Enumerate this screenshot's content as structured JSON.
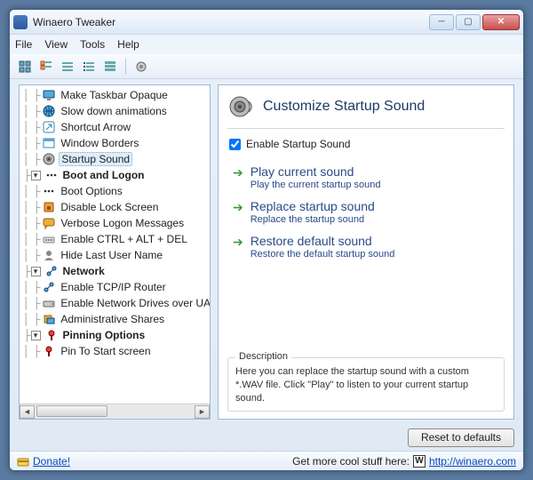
{
  "window": {
    "title": "Winaero Tweaker"
  },
  "menu": {
    "file": "File",
    "view": "View",
    "tools": "Tools",
    "help": "Help"
  },
  "tree": {
    "items": [
      {
        "indent": 2,
        "type": "leaf",
        "icon": "monitor",
        "label": "Make Taskbar Opaque"
      },
      {
        "indent": 2,
        "type": "leaf",
        "icon": "globe",
        "label": "Slow down animations"
      },
      {
        "indent": 2,
        "type": "leaf",
        "icon": "arrow",
        "label": "Shortcut Arrow"
      },
      {
        "indent": 2,
        "type": "leaf",
        "icon": "window",
        "label": "Window Borders"
      },
      {
        "indent": 2,
        "type": "leaf",
        "icon": "speaker",
        "label": "Startup Sound",
        "selected": true
      },
      {
        "indent": 1,
        "type": "group",
        "exp": "-",
        "icon": "dots",
        "label": "Boot and Logon"
      },
      {
        "indent": 2,
        "type": "leaf",
        "icon": "dots",
        "label": "Boot Options"
      },
      {
        "indent": 2,
        "type": "leaf",
        "icon": "lock",
        "label": "Disable Lock Screen"
      },
      {
        "indent": 2,
        "type": "leaf",
        "icon": "chat",
        "label": "Verbose Logon Messages"
      },
      {
        "indent": 2,
        "type": "leaf",
        "icon": "keys",
        "label": "Enable CTRL + ALT + DEL"
      },
      {
        "indent": 2,
        "type": "leaf",
        "icon": "user",
        "label": "Hide Last User Name"
      },
      {
        "indent": 1,
        "type": "group",
        "exp": "-",
        "icon": "net",
        "label": "Network"
      },
      {
        "indent": 2,
        "type": "leaf",
        "icon": "net",
        "label": "Enable TCP/IP Router"
      },
      {
        "indent": 2,
        "type": "leaf",
        "icon": "drive",
        "label": "Enable Network Drives over UAC"
      },
      {
        "indent": 2,
        "type": "leaf",
        "icon": "share",
        "label": "Administrative Shares"
      },
      {
        "indent": 1,
        "type": "group",
        "exp": "-",
        "icon": "pin",
        "label": "Pinning Options"
      },
      {
        "indent": 2,
        "type": "leaf",
        "icon": "pin",
        "label": "Pin To Start screen"
      }
    ]
  },
  "content": {
    "heading": "Customize Startup Sound",
    "enable_label": "Enable Startup Sound",
    "enable_checked": true,
    "actions": [
      {
        "title": "Play current sound",
        "desc": "Play the current startup sound"
      },
      {
        "title": "Replace startup sound",
        "desc": "Replace the startup sound"
      },
      {
        "title": "Restore default sound",
        "desc": "Restore the default startup sound"
      }
    ],
    "desc_legend": "Description",
    "desc_text": "Here you can replace the startup sound with a custom *.WAV file. Click \"Play\" to listen to your current startup sound."
  },
  "footer": {
    "reset_label": "Reset to defaults",
    "donate": "Donate!",
    "more_text": "Get more cool stuff here:",
    "url": "http://winaero.com"
  }
}
